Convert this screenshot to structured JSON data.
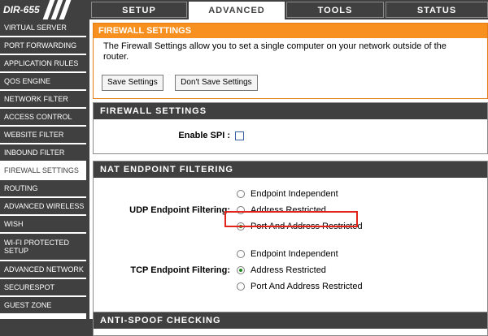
{
  "header": {
    "model": "DIR-655",
    "tabs": [
      {
        "label": "SETUP"
      },
      {
        "label": "ADVANCED"
      },
      {
        "label": "TOOLS"
      },
      {
        "label": "STATUS"
      }
    ],
    "active_tab": "ADVANCED"
  },
  "sidebar": {
    "items": [
      {
        "label": "VIRTUAL SERVER"
      },
      {
        "label": "PORT FORWARDING"
      },
      {
        "label": "APPLICATION RULES"
      },
      {
        "label": "QOS ENGINE"
      },
      {
        "label": "NETWORK FILTER"
      },
      {
        "label": "ACCESS CONTROL"
      },
      {
        "label": "WEBSITE FILTER"
      },
      {
        "label": "INBOUND FILTER"
      },
      {
        "label": "FIREWALL SETTINGS"
      },
      {
        "label": "ROUTING"
      },
      {
        "label": "ADVANCED WIRELESS"
      },
      {
        "label": "WISH"
      },
      {
        "label": "WI-FI PROTECTED SETUP"
      },
      {
        "label": "ADVANCED NETWORK"
      },
      {
        "label": "SECURESPOT"
      },
      {
        "label": "GUEST ZONE"
      }
    ],
    "active_item": "FIREWALL SETTINGS"
  },
  "firewall_intro": {
    "title": "FIREWALL SETTINGS",
    "description": "The Firewall Settings allow you to set a single computer on your network outside of the router.",
    "save_label": "Save Settings",
    "dont_save_label": "Don't Save Settings"
  },
  "firewall_settings": {
    "title": "FIREWALL SETTINGS",
    "spi_label": "Enable SPI :",
    "spi_checked": false
  },
  "nat_filtering": {
    "title": "NAT ENDPOINT FILTERING",
    "udp_label": "UDP Endpoint Filtering:",
    "tcp_label": "TCP Endpoint Filtering:",
    "udp_options": [
      {
        "label": "Endpoint Independent",
        "selected": false
      },
      {
        "label": "Address Restricted",
        "selected": false
      },
      {
        "label": "Port And Address Restricted",
        "selected": true
      }
    ],
    "tcp_options": [
      {
        "label": "Endpoint Independent",
        "selected": false
      },
      {
        "label": "Address Restricted",
        "selected": true
      },
      {
        "label": "Port And Address Restricted",
        "selected": false
      }
    ]
  },
  "anti_spoof": {
    "title": "ANTI-SPOOF CHECKING"
  },
  "colors": {
    "dark_bar": "#404040",
    "orange": "#f7901e",
    "highlight": "#e2231a",
    "radio_on": "#1a8a1a"
  }
}
